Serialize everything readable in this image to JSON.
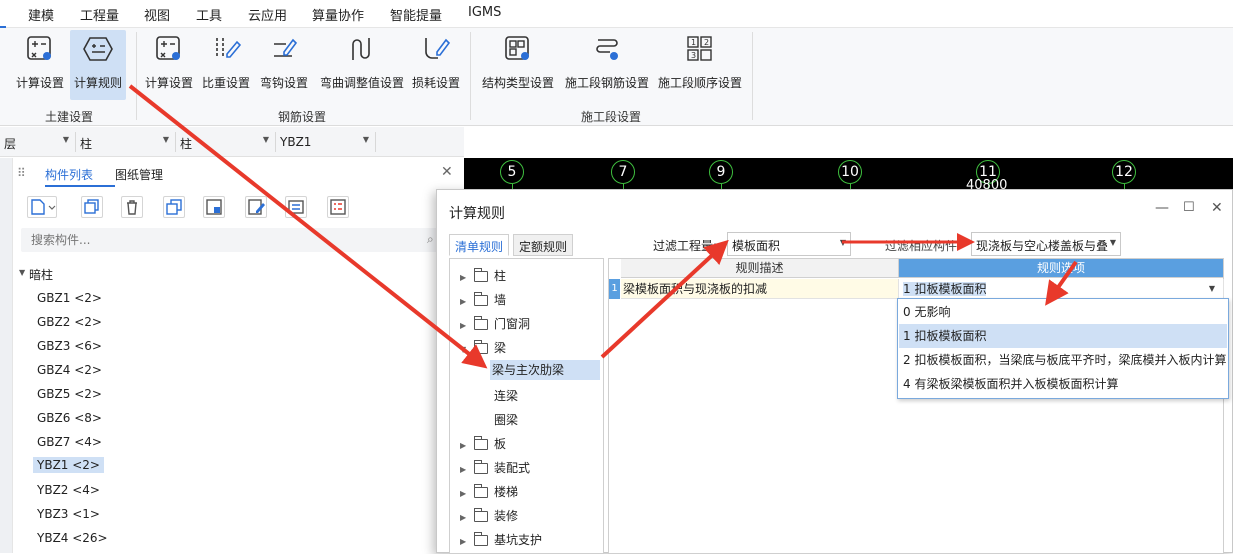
{
  "menu": {
    "items": [
      "建模",
      "工程量",
      "视图",
      "工具",
      "云应用",
      "算量协作",
      "智能提量",
      "IGMS"
    ]
  },
  "ribbon": {
    "groups": [
      {
        "label": "土建设置",
        "buttons": [
          "计算设置",
          "计算规则"
        ]
      },
      {
        "label": "钢筋设置",
        "buttons": [
          "计算设置",
          "比重设置",
          "弯钩设置",
          "弯曲调整值设置",
          "损耗设置"
        ]
      },
      {
        "label": "施工段设置",
        "buttons": [
          "结构类型设置",
          "施工段钢筋设置",
          "施工段顺序设置"
        ]
      }
    ],
    "active_button": "计算规则"
  },
  "selectors": {
    "floor": "层",
    "type1": "柱",
    "type2": "柱",
    "component": "YBZ1"
  },
  "left_panel": {
    "tabs": [
      "构件列表",
      "图纸管理"
    ],
    "search_placeholder": "搜索构件...",
    "category": "暗柱",
    "items": [
      "GBZ1 <2>",
      "GBZ2 <2>",
      "GBZ3 <6>",
      "GBZ4 <2>",
      "GBZ5 <2>",
      "GBZ6 <8>",
      "GBZ7 <4>",
      "YBZ1 <2>",
      "YBZ2 <4>",
      "YBZ3 <1>",
      "YBZ4 <26>"
    ],
    "selected": "YBZ1 <2>"
  },
  "canvas": {
    "axes": [
      "5",
      "7",
      "9",
      "10",
      "11",
      "12"
    ],
    "dimension": "40800"
  },
  "dialog": {
    "title": "计算规则",
    "tabs": [
      "清单规则",
      "定额规则"
    ],
    "filter_quantity_label": "过滤工程量:",
    "filter_quantity_value": "模板面积",
    "filter_component_label": "过滤相应构件",
    "filter_component_value": "现浇板与空心楼盖板与叠",
    "tree": [
      {
        "label": "柱",
        "kind": "folder"
      },
      {
        "label": "墙",
        "kind": "folder"
      },
      {
        "label": "门窗洞",
        "kind": "folder"
      },
      {
        "label": "梁",
        "kind": "folder-open"
      },
      {
        "label": "梁与主次肋梁",
        "kind": "child"
      },
      {
        "label": "连梁",
        "kind": "child"
      },
      {
        "label": "圈梁",
        "kind": "child"
      },
      {
        "label": "板",
        "kind": "folder"
      },
      {
        "label": "装配式",
        "kind": "folder"
      },
      {
        "label": "楼梯",
        "kind": "folder"
      },
      {
        "label": "装修",
        "kind": "folder"
      },
      {
        "label": "基坑支护",
        "kind": "folder"
      }
    ],
    "tree_selected": "梁与主次肋梁",
    "grid": {
      "headers": [
        "规则描述",
        "规则选项"
      ],
      "row_number": "1",
      "description": "梁模板面积与现浇板的扣减",
      "option": "1 扣板模板面积"
    },
    "dropdown_options": [
      "0  无影响",
      "1 扣板模板面积",
      "2 扣板模板面积，当梁底与板底平齐时，梁底模并入板内计算",
      "4 有梁板梁模板面积并入板模板面积计算"
    ],
    "dropdown_selected": "1 扣板模板面积"
  },
  "colors": {
    "accent": "#2b6fd6",
    "selection": "#cfe0f5",
    "grid_header": "#5a9fe0",
    "annotation_arrow": "#e8392b"
  }
}
